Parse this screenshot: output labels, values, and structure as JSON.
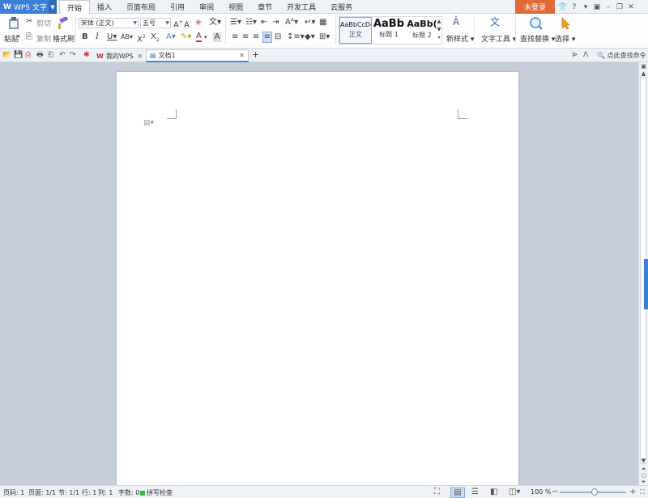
{
  "app": {
    "name": "WPS 文字",
    "logo": "W"
  },
  "menu_tabs": [
    {
      "label": "开始",
      "active": true
    },
    {
      "label": "插入"
    },
    {
      "label": "页面布局"
    },
    {
      "label": "引用"
    },
    {
      "label": "审阅"
    },
    {
      "label": "视图"
    },
    {
      "label": "章节"
    },
    {
      "label": "开发工具"
    },
    {
      "label": "云服务"
    }
  ],
  "login_label": "未登录",
  "ribbon": {
    "paste_label": "粘贴",
    "cut_label": "剪切",
    "copy_label": "复制",
    "format_painter_label": "格式刷",
    "font_name": "宋体 (正文)",
    "font_size": "五号",
    "styles": [
      {
        "preview": "AaBbCcDd",
        "name": "正文"
      },
      {
        "preview": "AaBb",
        "name": "标题 1"
      },
      {
        "preview": "AaBb(",
        "name": "标题 2"
      }
    ],
    "new_style_label": "新样式",
    "text_tools_label": "文字工具",
    "find_replace_label": "查找替换",
    "select_label": "选择"
  },
  "doc_tabs": [
    {
      "label": "我的WPS"
    },
    {
      "label": "文档1",
      "active": true
    }
  ],
  "search_command_label": "点此查找命令",
  "status": {
    "page_num": "页码: 1",
    "pages": "页面: 1/1",
    "section": "节: 1/1",
    "row": "行: 1",
    "col": "列: 1",
    "word_count": "字数: 0",
    "spell_check": "拼写检查",
    "zoom": "100 %"
  }
}
